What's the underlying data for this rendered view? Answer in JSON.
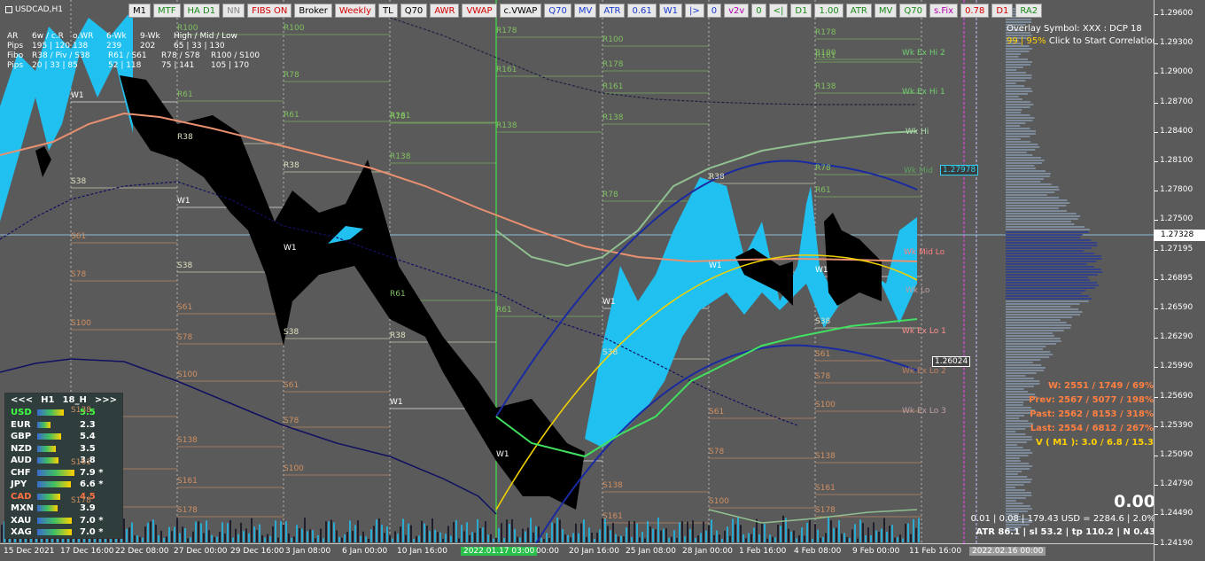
{
  "window": {
    "symbol_title": "USDCAD,H1"
  },
  "toolbar": [
    {
      "label": "M1",
      "cls": ""
    },
    {
      "label": "MTF",
      "cls": "green"
    },
    {
      "label": "HA D1",
      "cls": "green"
    },
    {
      "label": "NN",
      "cls": "gray"
    },
    {
      "label": "FIBS ON",
      "cls": "red"
    },
    {
      "label": "Broker",
      "cls": ""
    },
    {
      "label": "Weekly",
      "cls": "red"
    },
    {
      "label": "TL",
      "cls": ""
    },
    {
      "label": "Q70",
      "cls": ""
    },
    {
      "label": "AWR",
      "cls": "red"
    },
    {
      "label": "VWAP",
      "cls": "red"
    },
    {
      "label": "c.VWAP",
      "cls": ""
    },
    {
      "label": "Q70",
      "cls": "blue"
    },
    {
      "label": "MV",
      "cls": "blue"
    },
    {
      "label": "ATR",
      "cls": "blue"
    },
    {
      "label": "0.61",
      "cls": "blue"
    },
    {
      "label": "W1",
      "cls": "blue"
    },
    {
      "label": "|>",
      "cls": "blue"
    },
    {
      "label": "0",
      "cls": "blue"
    },
    {
      "label": "v2v",
      "cls": "mag"
    },
    {
      "label": "0",
      "cls": "green"
    },
    {
      "label": "<|",
      "cls": "green"
    },
    {
      "label": "D1",
      "cls": "green"
    },
    {
      "label": "1.00",
      "cls": "green"
    },
    {
      "label": "ATR",
      "cls": "green"
    },
    {
      "label": "MV",
      "cls": "green"
    },
    {
      "label": "Q70",
      "cls": "green"
    },
    {
      "label": "s.Fix",
      "cls": "mag"
    },
    {
      "label": "0.78",
      "cls": "red"
    },
    {
      "label": "D1",
      "cls": "red"
    },
    {
      "label": "RA2",
      "cls": "green"
    }
  ],
  "stats_table": {
    "row1": [
      "AR",
      "6w / c.R",
      "o.WR",
      "6-Wk",
      "9-Wk",
      "High / Mid / Low"
    ],
    "row2": [
      "Pips",
      "195 | 120",
      "138",
      "239",
      "202",
      "65 | 33 | 130"
    ],
    "row3": [
      "Fibo",
      "R38 / Piv / S38",
      "R61 / S61",
      "R78 / S78",
      "R100 / S100"
    ],
    "row4": [
      "Pips",
      "20 | 33 | 85",
      "52 | 118",
      "75 | 141",
      "105 | 170"
    ]
  },
  "overlay": {
    "line1": "Overlay Symbol: XXX : DCP 18",
    "pct": "99 | 95%",
    "line2": " Click to Start Correlation"
  },
  "stats_right": {
    "w": "W: 2551 / 1749 / 69%",
    "prev": "Prev: 2567 / 5077 / 198%",
    "past": "Past: 2562 / 8153 / 318%",
    "last": "Last: 2554 / 6812 / 267%",
    "vm1": "V ( M1 ): 3.0 / 6.8 / 15.3"
  },
  "bottom_info": {
    "big": "0.00",
    "line1": "0.01  |  0.08  |  179.43 USD = 2284.6  |  2.0%",
    "line2": "ATR 86.1  |  sl 53.2  |  tp 110.2  |  N 0.43"
  },
  "price_axis": {
    "labels": [
      "1.29600",
      "1.29300",
      "1.29000",
      "1.28700",
      "1.28400",
      "1.28100",
      "1.27800",
      "1.27500",
      "1.27195",
      "1.26895",
      "1.26590",
      "1.26290",
      "1.25990",
      "1.25690",
      "1.25390",
      "1.25090",
      "1.24790",
      "1.24490",
      "1.24190"
    ],
    "current": "1.27328"
  },
  "time_axis": {
    "labels": [
      "15 Dec 2021",
      "17 Dec 16:00",
      "22 Dec 08:00",
      "27 Dec 00:00",
      "29 Dec 16:00",
      "3 Jan 08:00",
      "6 Jan 00:00",
      "10 Jan 16:00",
      "2022.01.17 03:00",
      "00:00",
      "20 Jan 16:00",
      "25 Jan 08:00",
      "28 Jan 00:00",
      "1 Feb 16:00",
      "4 Feb 08:00",
      "9 Feb 00:00",
      "11 Feb 16:00",
      "2022.02.16 00:00"
    ]
  },
  "currency_panel": {
    "prev": "<<<",
    "tf": "H1",
    "period": "18_H",
    "next": ">>>",
    "rows": [
      {
        "name": "USD",
        "val": "5.5",
        "color": "#40ff40"
      },
      {
        "name": "EUR",
        "val": "2.3",
        "color": "#ffffff"
      },
      {
        "name": "GBP",
        "val": "5.4",
        "color": "#ffffff"
      },
      {
        "name": "NZD",
        "val": "3.5",
        "color": "#ffffff"
      },
      {
        "name": "AUD",
        "val": "3.8",
        "color": "#ffffff"
      },
      {
        "name": "CHF",
        "val": "7.9 *",
        "color": "#ffffff"
      },
      {
        "name": "JPY",
        "val": "6.6 *",
        "color": "#ffffff"
      },
      {
        "name": "CAD",
        "val": "4.5",
        "color": "#ff7040"
      },
      {
        "name": "MXN",
        "val": "3.9",
        "color": "#ffffff"
      },
      {
        "name": "XAU",
        "val": "7.0 *",
        "color": "#ffffff"
      },
      {
        "name": "XAG",
        "val": "7.0 *",
        "color": "#ffffff"
      }
    ]
  },
  "boxed_prices": {
    "upper": "1.27978",
    "lower": "1.26024"
  },
  "week_labels": [
    "Wk Ex Hi 2",
    "Wk Ex Hi 1",
    "Wk Hi",
    "Wk Mid",
    "Wk Mid Lo",
    "Wk Lo",
    "Wk Ex Lo 1",
    "Wk Ex Lo 2",
    "Wk Ex Lo 3"
  ],
  "pivot_labels": [
    "R100",
    "R78",
    "R61",
    "R38",
    "S38",
    "S61",
    "S78",
    "S100",
    "S138",
    "S161",
    "S178",
    "R138",
    "R161",
    "R178",
    "W1"
  ],
  "colors": {
    "bg": "#5a5a5a",
    "cyan": "#20c0f0",
    "black": "#000000",
    "salmon": "#e89070",
    "navy": "#101060",
    "yellow": "#f0d000",
    "green_line": "#40e060",
    "fib_orange": "#d09060",
    "fib_green": "#80c060"
  }
}
